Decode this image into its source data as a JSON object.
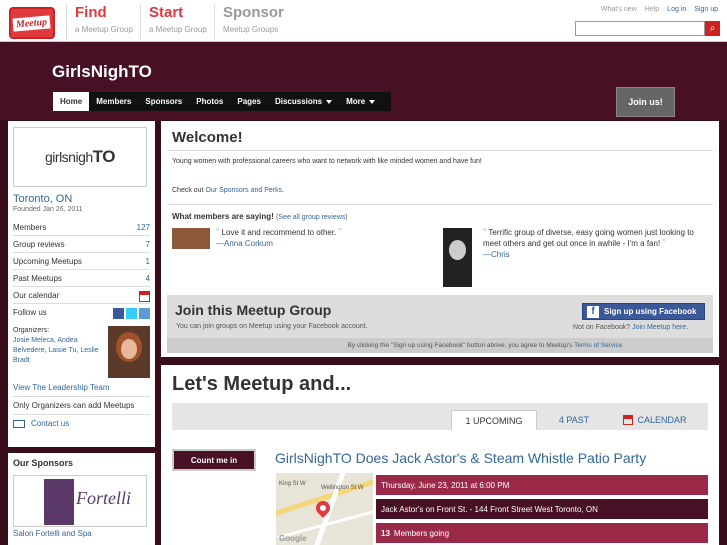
{
  "topnav": {
    "logo_text": "Meetup",
    "find": {
      "title": "Find",
      "subtitle": "a Meetup Group"
    },
    "start": {
      "title": "Start",
      "subtitle": "a Meetup Group"
    },
    "sponsor": {
      "title": "Sponsor",
      "subtitle": "Meetup Groups"
    },
    "utility_links": [
      "What's new",
      "Help",
      "Log in",
      "Sign up"
    ]
  },
  "group": {
    "title": "GirlsNighTO",
    "tabs": [
      "Home",
      "Members",
      "Sponsors",
      "Photos",
      "Pages",
      "Discussions",
      "More"
    ],
    "join_button": "Join us!"
  },
  "sidebar": {
    "logo_text_a": "girlsnigh",
    "logo_text_b": "TO",
    "city": "Toronto, ON",
    "founded": "Founded Jan 26, 2011",
    "stats": [
      {
        "label": "Members",
        "value": "127"
      },
      {
        "label": "Group reviews",
        "value": "7"
      },
      {
        "label": "Upcoming Meetups",
        "value": "1"
      },
      {
        "label": "Past Meetups",
        "value": "4"
      }
    ],
    "calendar_label": "Our calendar",
    "follow_label": "Follow us",
    "organizers_label": "Organizers:",
    "organizers": "Josie Meleca, Andea Belvedere, Laisie Tu, Leslie Bradt",
    "leadership_team": "View The Leadership Team",
    "only_organizers": "Only Organizers can add Meetups",
    "contact": "Contact us"
  },
  "sponsors": {
    "heading": "Our Sponsors",
    "sponsor_brand": "Fortelli",
    "sponsor_name": "Salon Fortelli and Spa"
  },
  "main": {
    "welcome": "Welcome!",
    "description": "Young women with professional careers who want to network with like minded women and have fun!",
    "checkout_prefix": "Check out ",
    "checkout_link": "Our Sponsors and Perks.",
    "saying_heading": "What members are saying!",
    "see_all": "(See all group reviews)",
    "review1": {
      "text": "Love it and recommend to other.",
      "author": "—Anna Corkum"
    },
    "review2": {
      "text": "Terrific group of diverse, easy going women just looking to meet others and get out once in awhile - I'm a fan!",
      "author": "—Chris"
    }
  },
  "joinbox": {
    "heading": "Join this Meetup Group",
    "sub": "You can join groups on Meetup using your Facebook account.",
    "fb_button": "Sign up using Facebook",
    "not_fb": "Not on Facebook?",
    "join_here": "Join Meetup here.",
    "tos_text": "By clicking the \"Sign up using Facebook\" button above, you agree to Meetup's",
    "tos_link": "Terms of Service"
  },
  "meetups": {
    "heading": "Let's Meetup and...",
    "tabs": [
      "1 UPCOMING",
      "4 PAST",
      "CALENDAR"
    ],
    "count_button": "Count me in",
    "event_title": "GirlsNighTO Does Jack Astor's & Steam Whistle Patio Party",
    "date": "Thursday, June 23, 2011 at 6:00 PM",
    "location": "Jack Astor's on Front St. - 144 Front Street West Toronto, ON",
    "going_count": "13",
    "going_label": "Members going",
    "map_labels": [
      "Wellington St W",
      "King St W"
    ],
    "map_google": "Google"
  }
}
